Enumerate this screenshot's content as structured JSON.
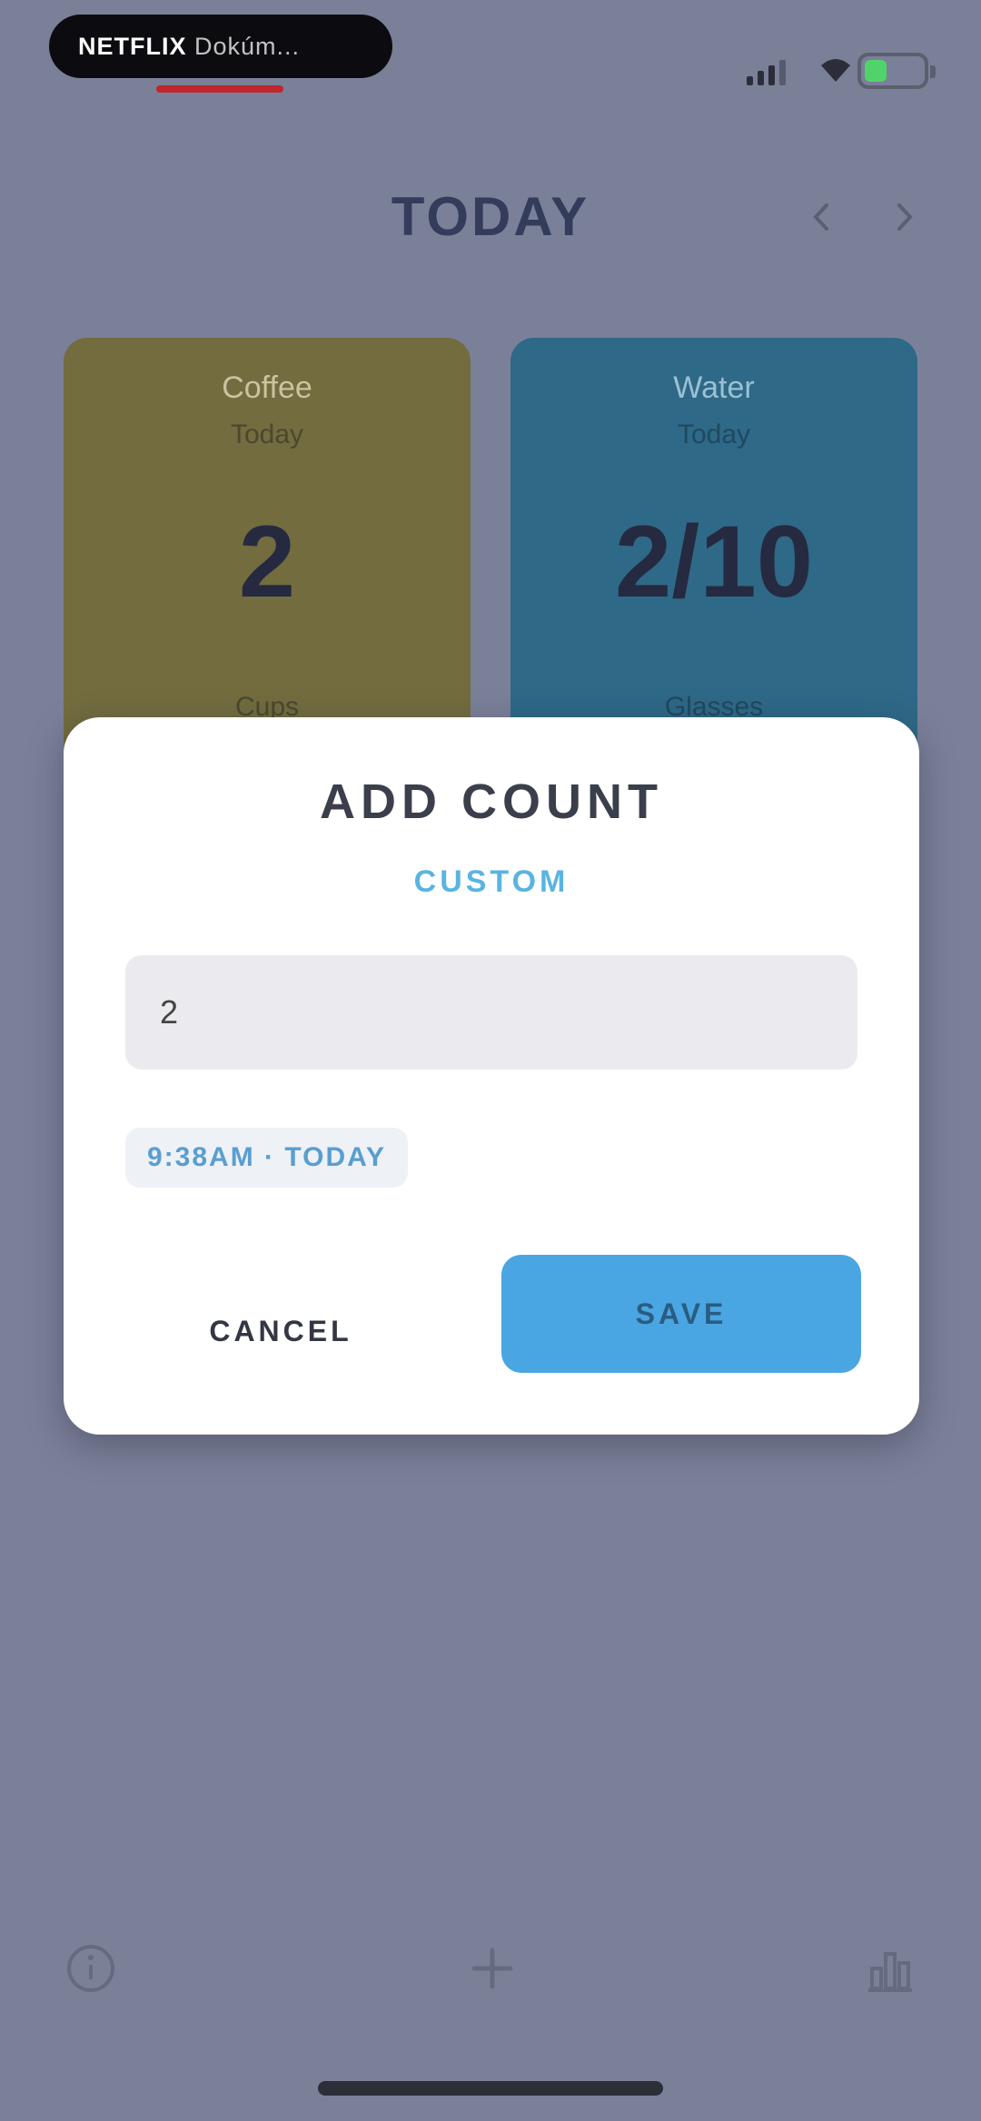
{
  "status_bar": {
    "pill_text_bold": "NETFLIX",
    "pill_text_light": "Dokúm..."
  },
  "header": {
    "title": "TODAY",
    "icons": [
      "chevron-left-icon",
      "chevron-right-icon"
    ]
  },
  "cards": [
    {
      "name": "Coffee",
      "subtitle": "Today",
      "value": "2",
      "footer": "Cups"
    },
    {
      "name": "Water",
      "subtitle": "Today",
      "value": "2/10",
      "footer": "Glasses"
    }
  ],
  "dialog": {
    "title": "ADD COUNT",
    "subtitle": "CUSTOM",
    "input_value": "2",
    "chip": "9:38AM · TODAY",
    "cancel_label": "CANCEL",
    "save_label": "SAVE"
  },
  "bottom_nav": {
    "icons": [
      "info-icon",
      "add-icon",
      "stats-icon"
    ]
  },
  "colors": {
    "background": "#7b8099",
    "card_yellow": "#726c3f",
    "card_blue": "#2e6987",
    "accent": "#4aa6e2"
  }
}
